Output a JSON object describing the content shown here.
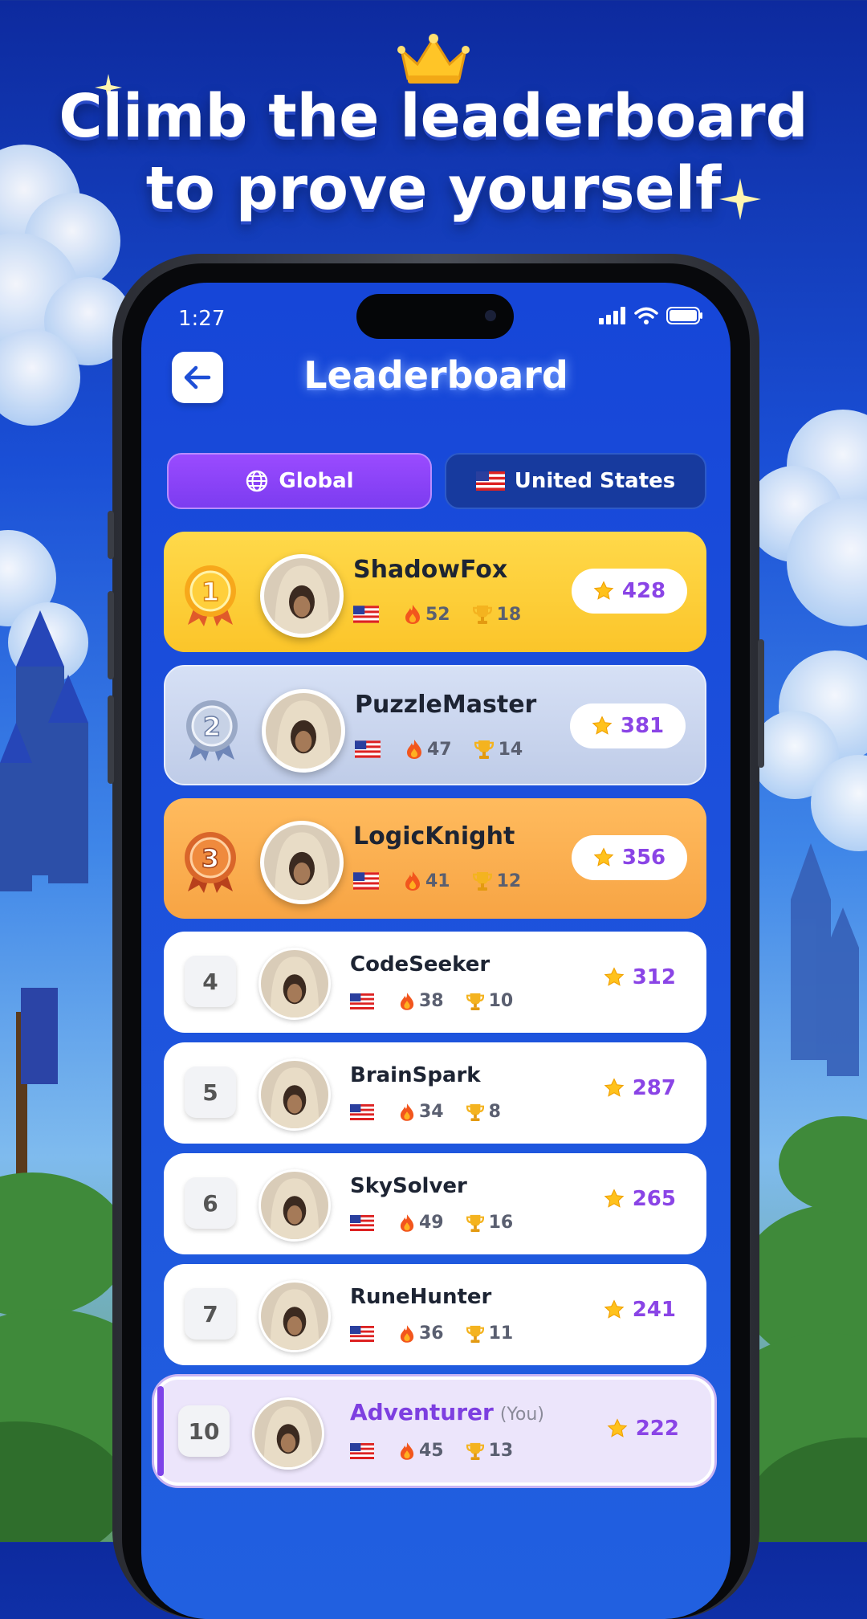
{
  "promo": {
    "headline_line1": "Climb the leaderboard",
    "headline_line2": "to prove yourself"
  },
  "status_bar": {
    "time": "1:27"
  },
  "header": {
    "title": "Leaderboard"
  },
  "tabs": [
    {
      "label": "Global",
      "icon": "globe-icon",
      "active": true
    },
    {
      "label": "United States",
      "icon": "us-flag-icon",
      "active": false
    }
  ],
  "players": [
    {
      "rank": "1",
      "name": "ShadowFox",
      "streak": "52",
      "trophies": "18",
      "score": "428"
    },
    {
      "rank": "2",
      "name": "PuzzleMaster",
      "streak": "47",
      "trophies": "14",
      "score": "381"
    },
    {
      "rank": "3",
      "name": "LogicKnight",
      "streak": "41",
      "trophies": "12",
      "score": "356"
    },
    {
      "rank": "4",
      "name": "CodeSeeker",
      "streak": "38",
      "trophies": "10",
      "score": "312"
    },
    {
      "rank": "5",
      "name": "BrainSpark",
      "streak": "34",
      "trophies": "8",
      "score": "287"
    },
    {
      "rank": "6",
      "name": "SkySolver",
      "streak": "49",
      "trophies": "16",
      "score": "265"
    },
    {
      "rank": "7",
      "name": "RuneHunter",
      "streak": "36",
      "trophies": "11",
      "score": "241"
    }
  ],
  "current_user": {
    "rank": "10",
    "name": "Adventurer",
    "you_tag": "(You)",
    "streak": "45",
    "trophies": "13",
    "score": "222"
  },
  "colors": {
    "accent": "#8a44e6",
    "gold": "#fbc52a",
    "silver": "#c8d3ec",
    "bronze": "#f7a444",
    "screen_blue": "#1a4cdb"
  }
}
